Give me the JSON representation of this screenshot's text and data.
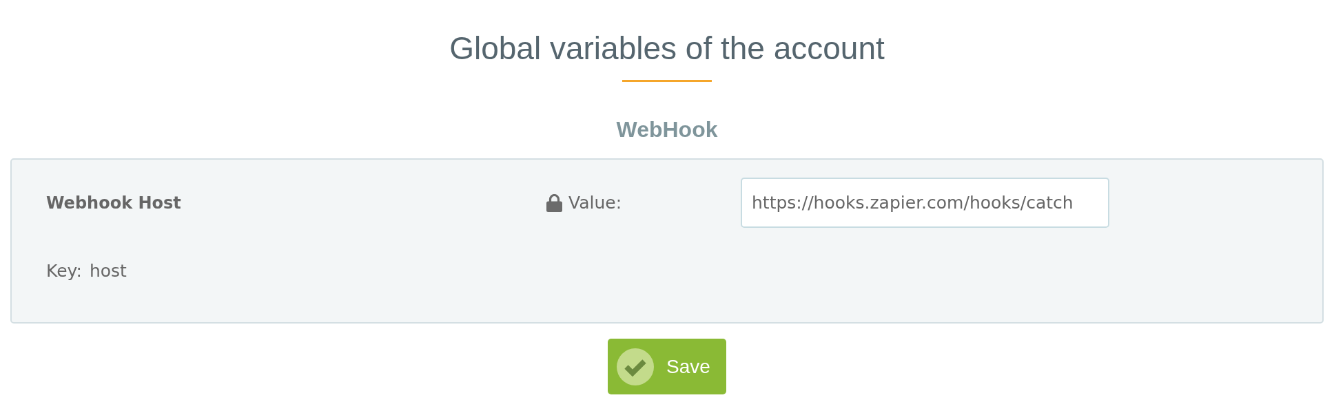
{
  "page": {
    "title": "Global variables of the account"
  },
  "section": {
    "title": "WebHook"
  },
  "variables": [
    {
      "name": "Webhook Host",
      "locked": true,
      "value_label": "Value:",
      "value": "https://hooks.zapier.com/hooks/catch",
      "key_label": "Key:",
      "key": "host"
    }
  ],
  "save_button": {
    "label": "Save"
  }
}
